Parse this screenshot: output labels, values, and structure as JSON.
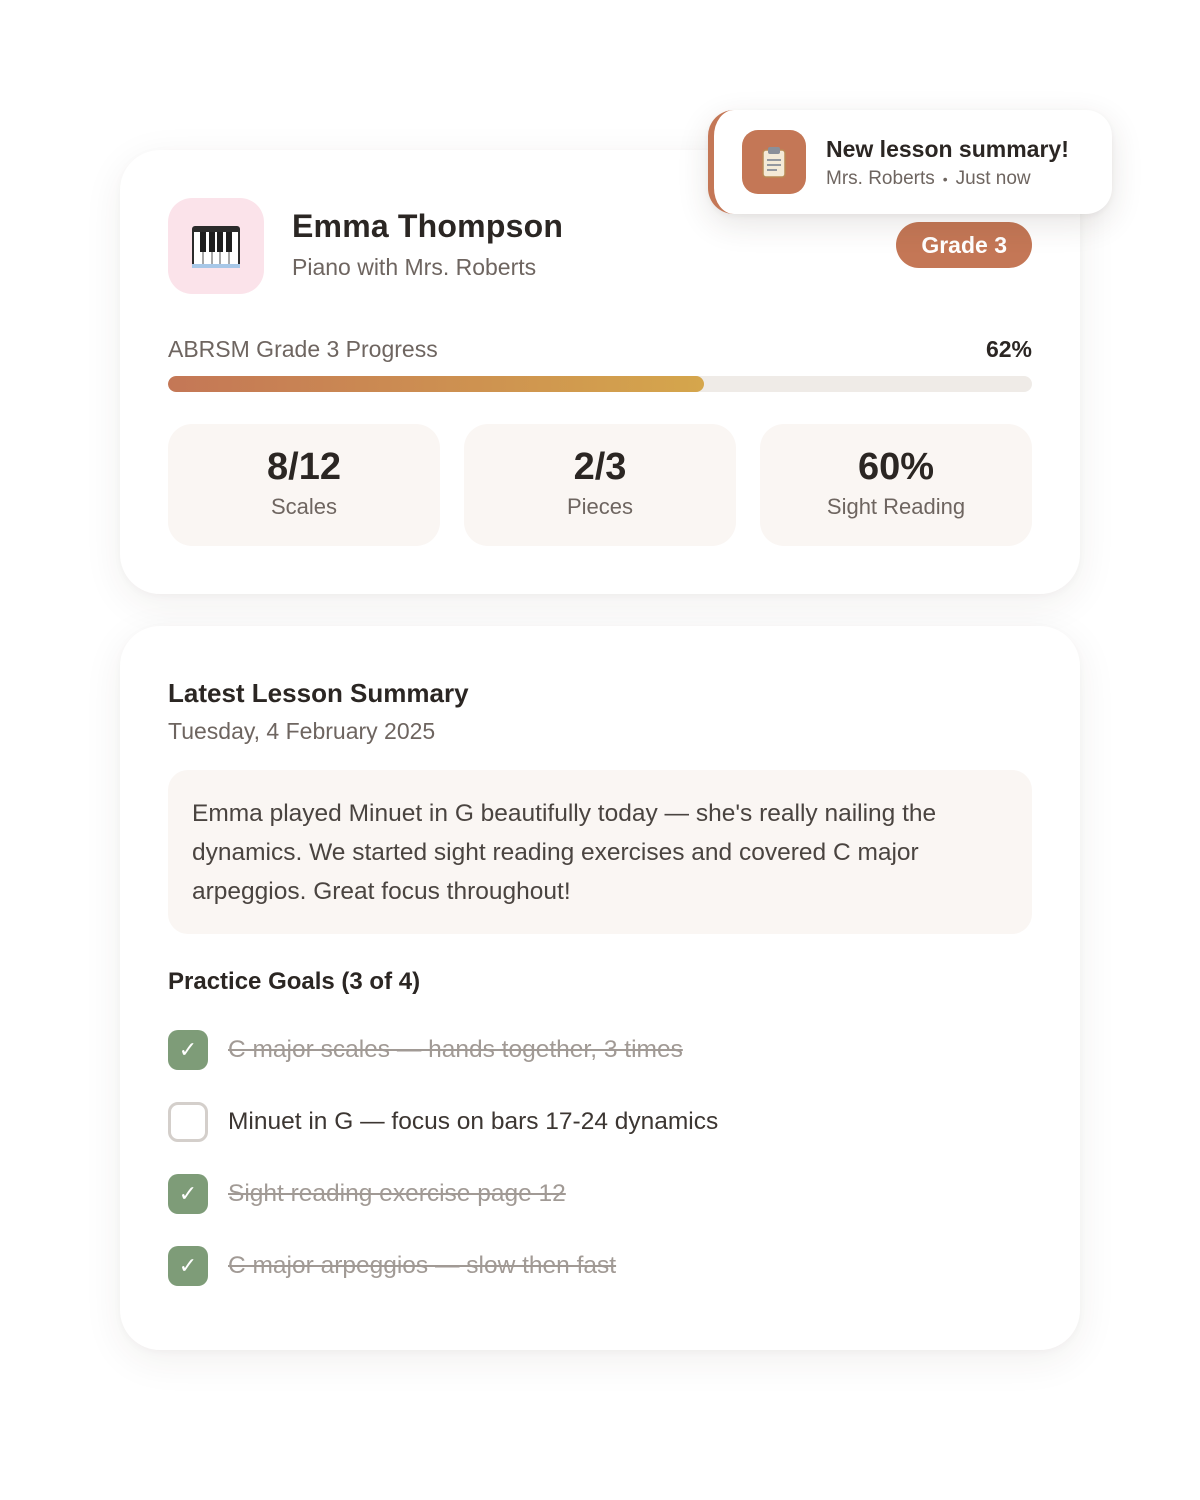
{
  "student": {
    "avatar_icon": "piano-keys-icon",
    "name": "Emma Thompson",
    "subtitle": "Piano with Mrs. Roberts",
    "grade_badge": "Grade 3"
  },
  "progress": {
    "label": "ABRSM Grade 3 Progress",
    "percent_text": "62%",
    "value": 0.62
  },
  "stats": [
    {
      "value": "8/12",
      "label": "Scales"
    },
    {
      "value": "2/3",
      "label": "Pieces"
    },
    {
      "value": "60%",
      "label": "Sight Reading"
    }
  ],
  "notification": {
    "icon": "clipboard-icon",
    "title": "New lesson summary!",
    "sender": "Mrs. Roberts",
    "time": "Just now"
  },
  "lesson": {
    "title": "Latest Lesson Summary",
    "date": "Tuesday, 4 February 2025",
    "summary": "Emma played Minuet in G beautifully today — she's really nailing the dynamics. We started sight reading exercises and covered C major arpeggios. Great focus throughout!"
  },
  "goals": {
    "title": "Practice Goals (3 of 4)",
    "items": [
      {
        "text": "C major scales — hands together, 3 times",
        "done": true
      },
      {
        "text": "Minuet in G — focus on bars 17-24 dynamics",
        "done": false
      },
      {
        "text": "Sight reading exercise page 12",
        "done": true
      },
      {
        "text": "C major arpeggios — slow then fast",
        "done": true
      }
    ]
  },
  "colors": {
    "accent": "#c47756",
    "gold": "#d5a64c",
    "check_green": "#7e9c78",
    "avatar_bg": "#fbe3ea"
  }
}
